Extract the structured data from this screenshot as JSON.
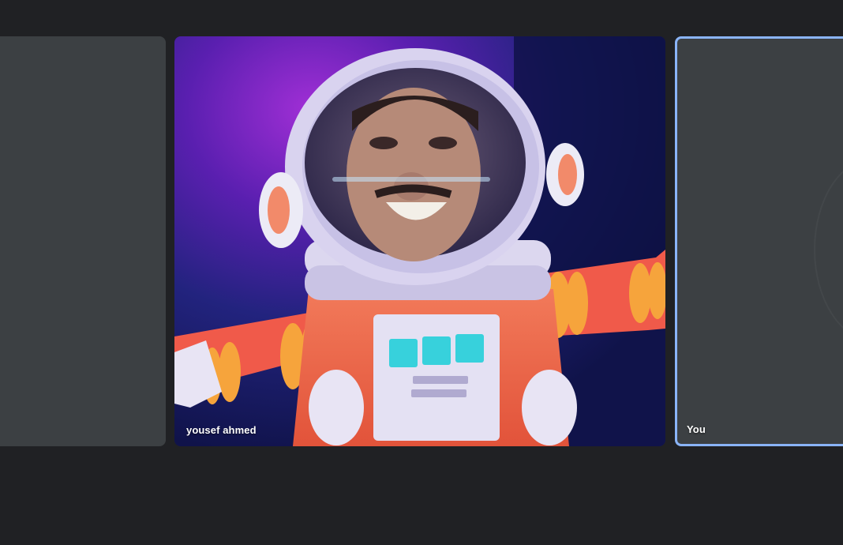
{
  "participants": [
    {
      "name": ""
    },
    {
      "name": "yousef ahmed"
    },
    {
      "name": "You"
    }
  ],
  "colors": {
    "background": "#202124",
    "tile": "#3c4043",
    "active_speaker_border": "#8ab4f8"
  }
}
